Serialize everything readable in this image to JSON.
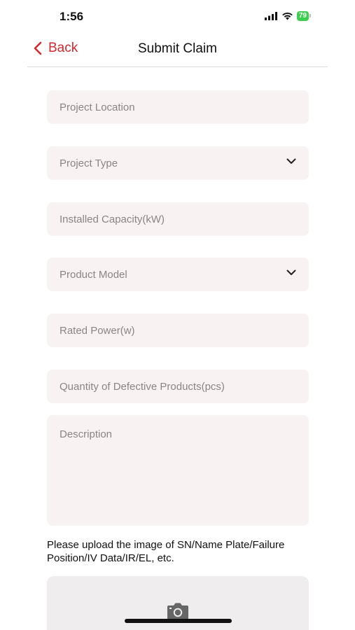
{
  "status_bar": {
    "time": "1:56",
    "battery": "79"
  },
  "nav": {
    "back_label": "Back",
    "title": "Submit Claim",
    "accent_color": "#d02a2f"
  },
  "form": {
    "project_location": {
      "placeholder": "Project Location"
    },
    "project_type": {
      "placeholder": "Project Type"
    },
    "installed_capacity": {
      "placeholder": "Installed Capacity(kW)"
    },
    "product_model": {
      "placeholder": "Product Model"
    },
    "rated_power": {
      "placeholder": "Rated Power(w)"
    },
    "defective_quantity": {
      "placeholder": "Quantity of Defective Products(pcs)"
    },
    "description": {
      "placeholder": "Description"
    }
  },
  "upload": {
    "hint": "Please upload the image of SN/Name Plate/Failure Position/IV Data/IR/EL, etc.",
    "icon": "camera-icon"
  }
}
